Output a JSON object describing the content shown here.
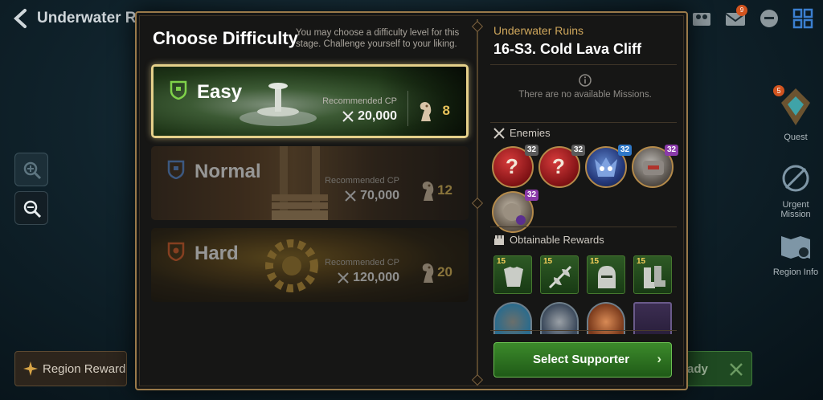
{
  "topbar": {
    "title": "Underwater Ruins",
    "mail_badge": "9"
  },
  "bottom": {
    "region_reward_label": "Region Reward",
    "ready_label": "ady"
  },
  "side_nav": {
    "quest_label": "Quest",
    "quest_badge": "5",
    "urgent_label": "Urgent\nMission",
    "region_info_label": "Region Info"
  },
  "modal": {
    "title": "Choose Difficulty",
    "description": "You may choose a difficulty level for this stage. Challenge yourself to your liking.",
    "recommended_label": "Recommended CP",
    "difficulties": [
      {
        "name": "Easy",
        "cp": "20,000",
        "stamina": "8",
        "selected": true,
        "color": "#7fd24a"
      },
      {
        "name": "Normal",
        "cp": "70,000",
        "stamina": "12",
        "selected": false,
        "color": "#5b8fd9"
      },
      {
        "name": "Hard",
        "cp": "120,000",
        "stamina": "20",
        "selected": false,
        "color": "#e0622a"
      }
    ]
  },
  "stage": {
    "region": "Underwater Ruins",
    "name": "16-S3. Cold Lava Cliff",
    "missions_text": "There are no available Missions.",
    "enemies_label": "Enemies",
    "enemies": [
      {
        "icon": "unknown-enemy-icon",
        "level": "32",
        "level_color": "#5a5a5a"
      },
      {
        "icon": "unknown-enemy-icon",
        "level": "32",
        "level_color": "#5a5a5a"
      },
      {
        "icon": "blue-creature-icon",
        "level": "32",
        "level_color": "#2f78c8"
      },
      {
        "icon": "armored-golem-icon",
        "level": "32",
        "level_color": "#8a3aa8"
      },
      {
        "icon": "stone-golem-icon",
        "level": "32",
        "level_color": "#8a3aa8"
      }
    ],
    "rewards_label": "Obtainable Rewards",
    "rewards": [
      {
        "icon": "armor-icon",
        "level": "15"
      },
      {
        "icon": "axe-icon",
        "level": "15"
      },
      {
        "icon": "helmet-icon",
        "level": "15"
      },
      {
        "icon": "boots-icon",
        "level": "15"
      }
    ],
    "select_supporter_label": "Select Supporter"
  }
}
